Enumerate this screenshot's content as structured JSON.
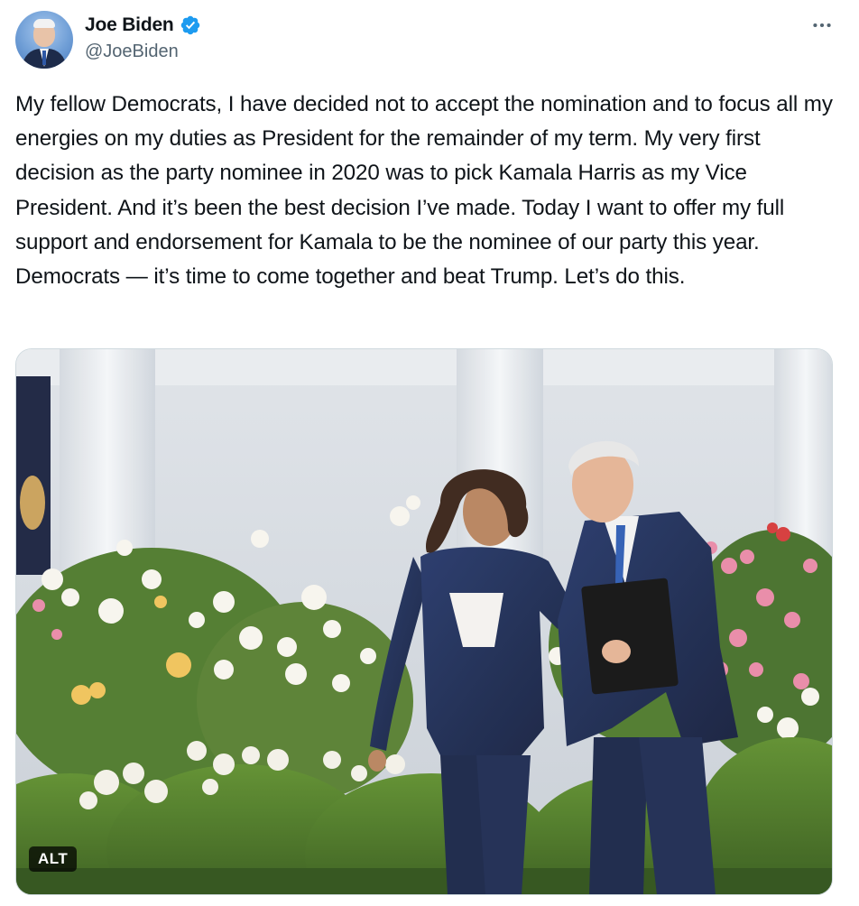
{
  "author": {
    "display_name": "Joe Biden",
    "handle": "@JoeBiden",
    "verified_icon": "verified-badge-icon",
    "verified_color": "#1d9bf0"
  },
  "menu": {
    "more_icon": "more-horizontal-icon"
  },
  "tweet": {
    "text": "My fellow Democrats, I have decided not to accept the nomination and to focus all my energies on my duties as President for the remainder of my term. My very first decision as the party nominee in 2020 was to pick Kamala Harris as my Vice President. And it’s been the best decision I’ve made. Today I want to offer my full support and endorsement for Kamala to be the nominee of our party this year. Democrats — it’s time to come together and beat Trump. Let’s do this."
  },
  "media": {
    "alt_label": "ALT"
  },
  "colors": {
    "text_primary": "#0f1419",
    "text_secondary": "#536471",
    "suit_navy": "#1c2a4d",
    "hedge_green": "#3f6b22"
  }
}
